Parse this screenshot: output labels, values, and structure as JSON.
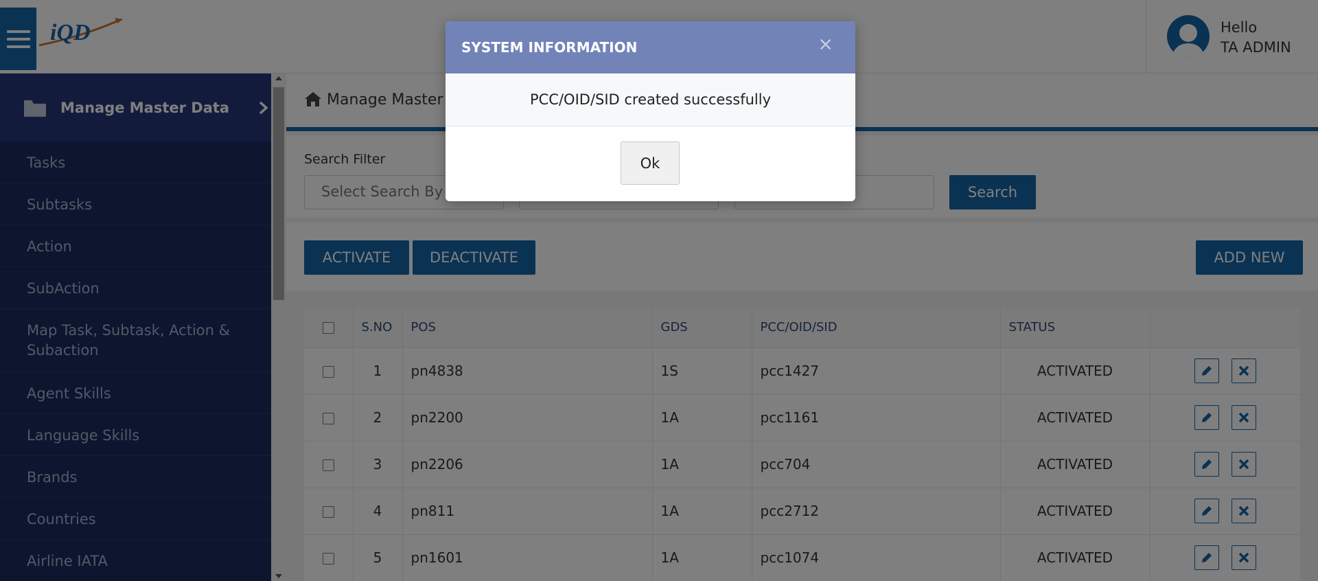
{
  "header": {
    "logo_text": "iQD",
    "greeting": "Hello",
    "user_name": "TA ADMIN"
  },
  "sidebar": {
    "title": "Manage Master Data",
    "items": [
      {
        "label": "Tasks"
      },
      {
        "label": "Subtasks"
      },
      {
        "label": "Action"
      },
      {
        "label": "SubAction"
      },
      {
        "label": "Map Task, Subtask, Action & Subaction"
      },
      {
        "label": "Agent Skills"
      },
      {
        "label": "Language Skills"
      },
      {
        "label": "Brands"
      },
      {
        "label": "Countries"
      },
      {
        "label": "Airline IATA"
      }
    ]
  },
  "breadcrumb": {
    "text": "Manage Master D"
  },
  "filter": {
    "label": "Search Filter",
    "select_placeholder": "Select Search By",
    "field2_value": "",
    "field3_value": "",
    "search_button": "Search"
  },
  "actions": {
    "activate": "ACTIVATE",
    "deactivate": "DEACTIVATE",
    "add_new": "ADD NEW"
  },
  "table": {
    "headers": {
      "sno": "S.NO",
      "pos": "POS",
      "gds": "GDS",
      "pcc": "PCC/OID/SID",
      "status": "STATUS"
    },
    "rows": [
      {
        "sno": "1",
        "pos": "pn4838",
        "gds": "1S",
        "pcc": "pcc1427",
        "status": "ACTIVATED"
      },
      {
        "sno": "2",
        "pos": "pn2200",
        "gds": "1A",
        "pcc": "pcc1161",
        "status": "ACTIVATED"
      },
      {
        "sno": "3",
        "pos": "pn2206",
        "gds": "1A",
        "pcc": "pcc704",
        "status": "ACTIVATED"
      },
      {
        "sno": "4",
        "pos": "pn811",
        "gds": "1A",
        "pcc": "pcc2712",
        "status": "ACTIVATED"
      },
      {
        "sno": "5",
        "pos": "pn1601",
        "gds": "1A",
        "pcc": "pcc1074",
        "status": "ACTIVATED"
      }
    ]
  },
  "modal": {
    "title": "SYSTEM INFORMATION",
    "close_glyph": "×",
    "message": "PCC/OID/SID created successfully",
    "ok_label": "Ok"
  },
  "colors": {
    "primary": "#1565a7",
    "sidebar_bg": "#1a2b5f",
    "sidebar_header_bg": "#27377a",
    "modal_header_bg": "#7283b8"
  }
}
